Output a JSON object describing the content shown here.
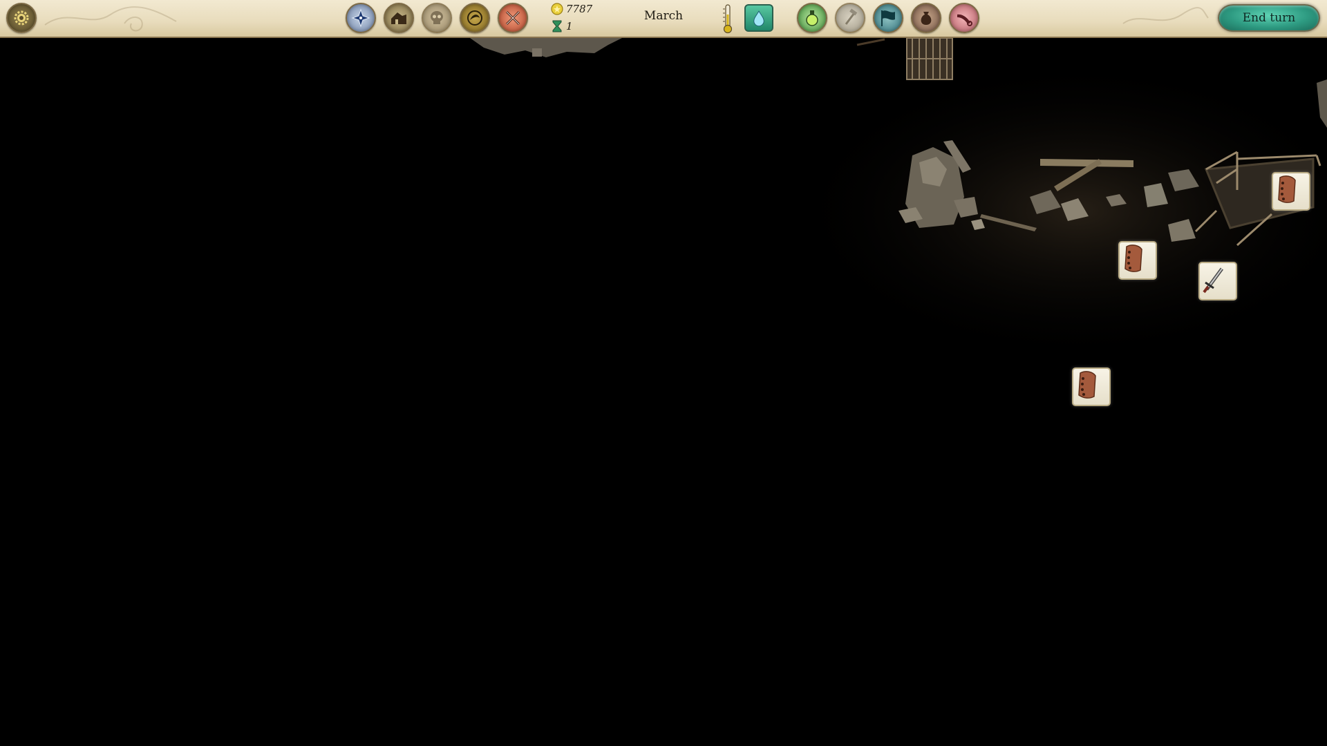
{
  "hud": {
    "gold": "7787",
    "turn": "1",
    "month": "March",
    "end_turn_label": "End turn"
  },
  "icons": {
    "settings": "gear-icon",
    "left_buttons": [
      "compass-icon",
      "house-icon",
      "skull-icon",
      "faith-icon",
      "crossed-swords-icon"
    ],
    "resources": [
      "gold-coin-icon",
      "hourglass-icon"
    ],
    "weather": [
      "thermometer-icon",
      "water-drop-icon"
    ],
    "right_buttons": [
      "potion-icon",
      "hammer-icon",
      "flag-icon",
      "bag-icon",
      "horn-icon"
    ],
    "map_markers": [
      "leather-armor-icon",
      "leather-armor-icon",
      "sword-icon",
      "leather-armor-icon"
    ]
  },
  "colors": {
    "parchment": "#ece2c6",
    "end_turn": "#2e9b82",
    "background": "#000000"
  }
}
